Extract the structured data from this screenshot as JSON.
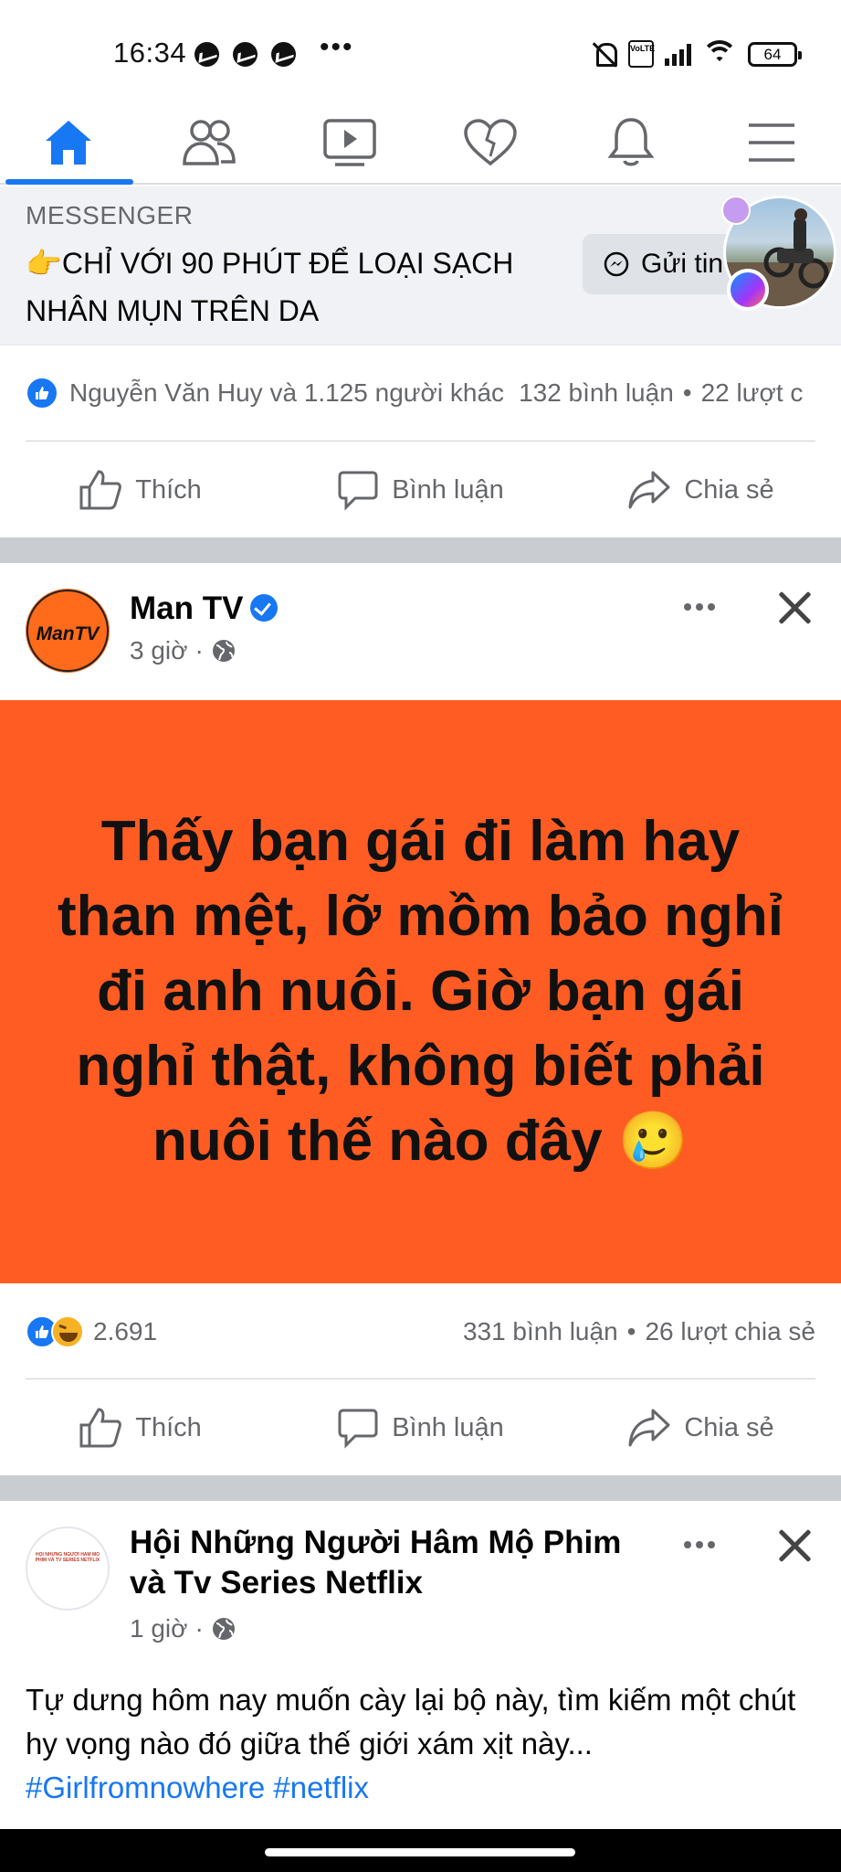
{
  "status_bar": {
    "time": "16:34",
    "overflow": "•••",
    "battery": "64",
    "network": "VoLTE"
  },
  "nav": {
    "tabs": [
      "home-icon",
      "friends-icon",
      "watch-icon",
      "dating-icon",
      "notifications-icon",
      "menu-icon"
    ],
    "active": "home"
  },
  "ad": {
    "label": "MESSENGER",
    "text": "👉CHỈ VỚI 90 PHÚT ĐỂ LOẠI SẠCH NHÂN MỤN TRÊN DA",
    "button": "Gửi tin"
  },
  "post1": {
    "reactions": "Nguyễn Văn Huy và 1.125 người khác",
    "comments": "132 bình luận",
    "shares": "22 lượt c",
    "dot": "•"
  },
  "actions": {
    "like": "Thích",
    "comment": "Bình luận",
    "share": "Chia sẻ"
  },
  "post2": {
    "page_name": "Man TV",
    "avatar_text": "ManTV",
    "time": "3 giờ",
    "dot": "·",
    "content": "Thấy bạn gái đi làm hay than mệt, lỡ mồm bảo nghỉ đi anh nuôi. Giờ bạn gái nghỉ thật, không biết phải nuôi thế nào đây 🥲",
    "reaction_count": "2.691",
    "comments": "331 bình luận",
    "shares": "26 lượt chia sẻ",
    "stats_dot": "•"
  },
  "post3": {
    "page_name": "Hội Những Người Hâm Mộ Phim và Tv Series Netflix",
    "avatar_text": "HỘI NHỮNG NGƯỜI HÂM MỘ PHIM VÀ TV SERIES NETFLIX",
    "time": "1 giờ",
    "dot": "·",
    "body": "Tự dưng hôm nay muốn cày lại bộ này, tìm kiếm một chút hy vọng nào đó giữa thế giới xám xịt này...",
    "hashtags": "#Girlfromnowhere #netflix"
  },
  "colors": {
    "brand": "#1877f2",
    "post_background": "#fe5c22",
    "secondary_text": "#65676b"
  }
}
